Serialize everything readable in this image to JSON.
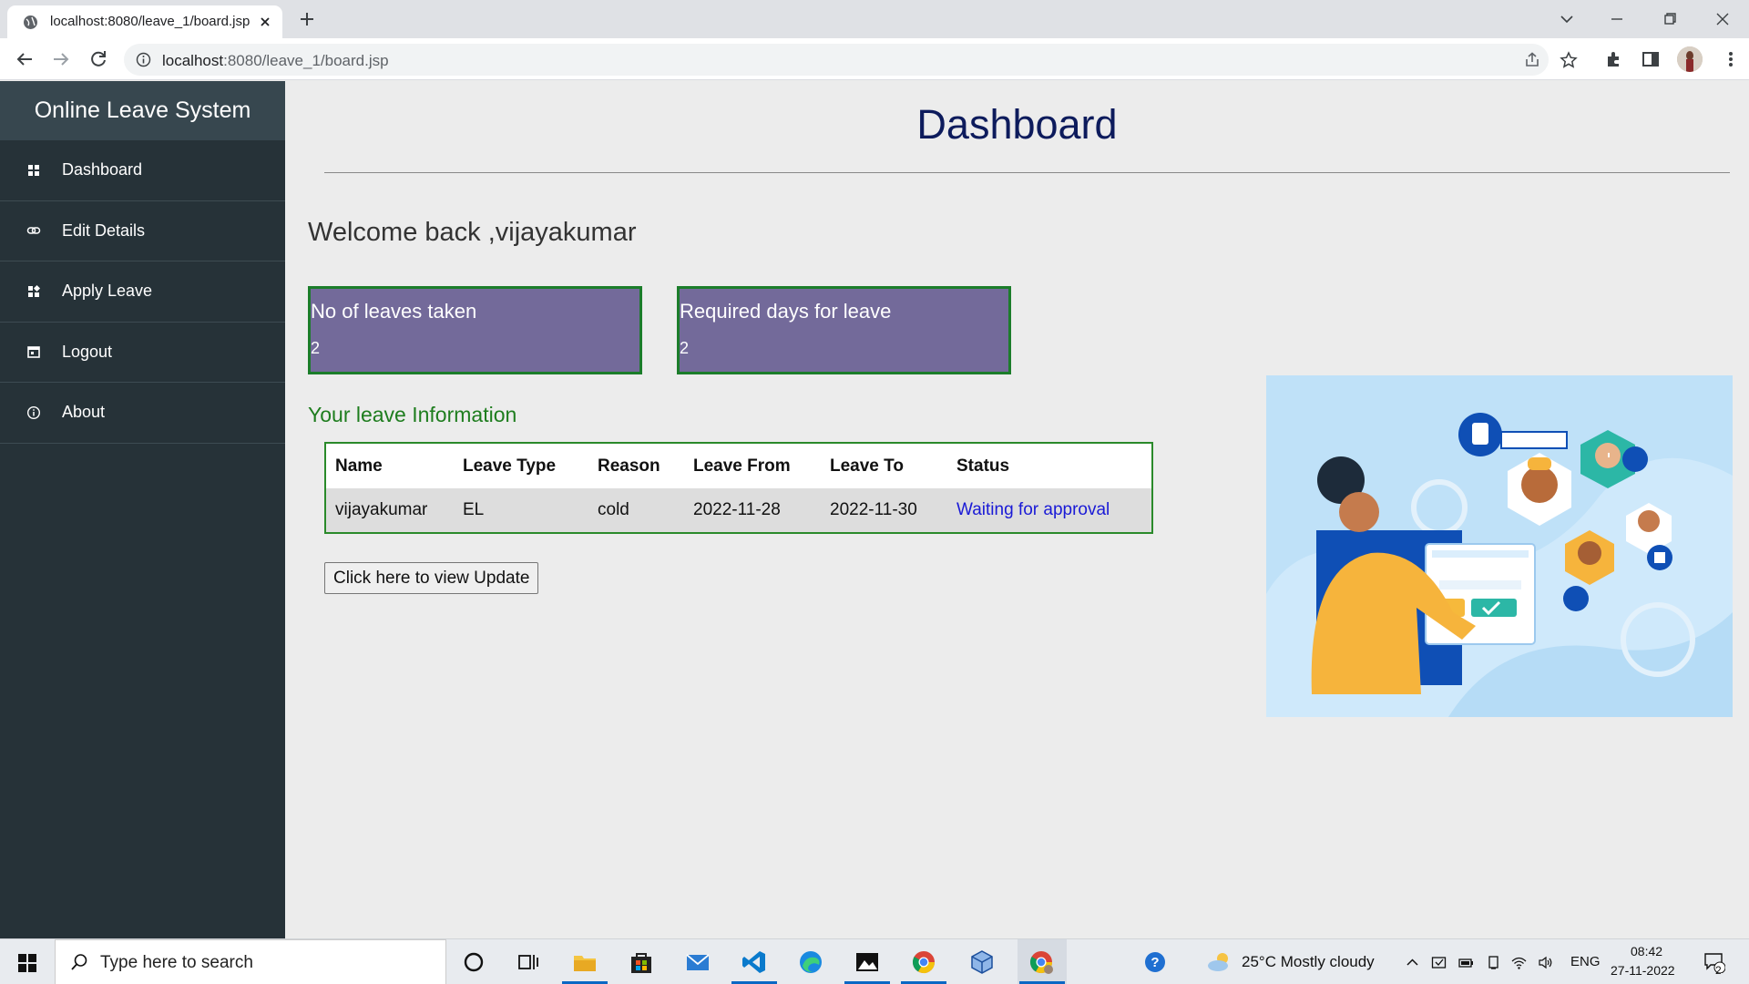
{
  "browser": {
    "tab_title": "localhost:8080/leave_1/board.jsp",
    "url_host": "localhost",
    "url_path": ":8080/leave_1/board.jsp"
  },
  "sidebar": {
    "brand": "Online Leave System",
    "items": [
      {
        "label": "Dashboard",
        "icon": "grid-icon"
      },
      {
        "label": "Edit Details",
        "icon": "link-icon"
      },
      {
        "label": "Apply Leave",
        "icon": "apps-icon"
      },
      {
        "label": "Logout",
        "icon": "calendar-icon"
      },
      {
        "label": "About",
        "icon": "info-icon"
      }
    ]
  },
  "main": {
    "title": "Dashboard",
    "welcome": "Welcome back ,vijayakumar",
    "cards": [
      {
        "label": "No of leaves taken",
        "value": "2"
      },
      {
        "label": "Required days for leave",
        "value": "2"
      }
    ],
    "section_heading": "Your leave Information",
    "table": {
      "headers": [
        "Name",
        "Leave Type",
        "Reason",
        "Leave From",
        "Leave To",
        "Status"
      ],
      "rows": [
        [
          "vijayakumar",
          "EL",
          "cold",
          "2022-11-28",
          "2022-11-30",
          "Waiting for approval"
        ]
      ]
    },
    "update_button": "Click here to view Update"
  },
  "colors": {
    "sidebar_bg": "#263238",
    "brand_bg": "#37474f",
    "card_bg": "#736a9a",
    "card_border": "#1b7d2a",
    "title_color": "#0d1b5c",
    "status_link": "#1a1ad6"
  },
  "taskbar": {
    "search_placeholder": "Type here to search",
    "weather": "25°C  Mostly cloudy",
    "language": "ENG",
    "time": "08:42",
    "date": "27-11-2022",
    "notifications": "2"
  }
}
